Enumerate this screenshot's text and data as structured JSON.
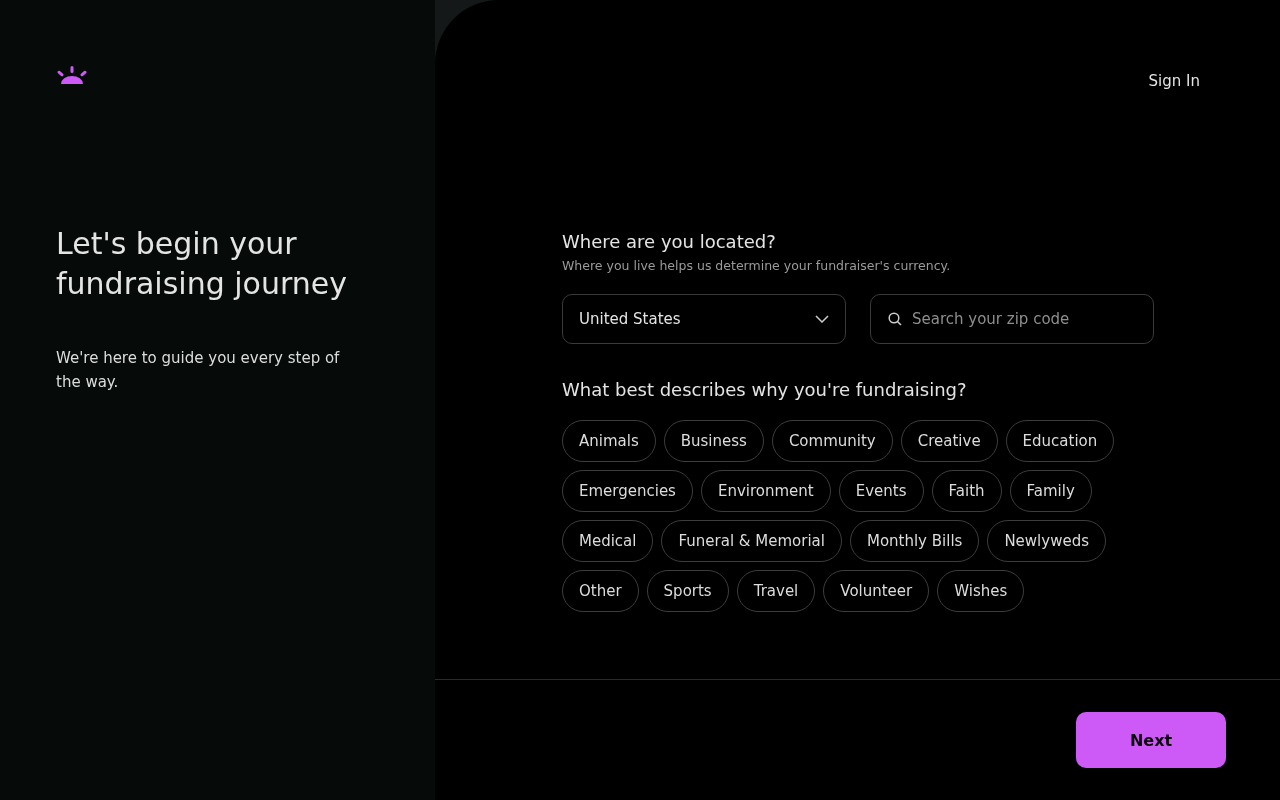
{
  "sidebar": {
    "heading": "Let's begin your fundraising journey",
    "subtext": "We're here to guide you every step of the way."
  },
  "header": {
    "sign_in": "Sign In"
  },
  "location": {
    "question": "Where are you located?",
    "hint": "Where you live helps us determine your fundraiser's currency.",
    "country": "United States",
    "zip": {
      "placeholder": "Search your zip code"
    }
  },
  "reason": {
    "question": "What best describes why you're fundraising?",
    "categories": [
      {
        "label": "Animals",
        "selected": false
      },
      {
        "label": "Business",
        "selected": false
      },
      {
        "label": "Community",
        "selected": false
      },
      {
        "label": "Creative",
        "selected": false
      },
      {
        "label": "Education",
        "selected": false
      },
      {
        "label": "Emergencies",
        "selected": false
      },
      {
        "label": "Environment",
        "selected": false
      },
      {
        "label": "Events",
        "selected": false
      },
      {
        "label": "Faith",
        "selected": false
      },
      {
        "label": "Family",
        "selected": false
      },
      {
        "label": "Medical",
        "selected": false
      },
      {
        "label": "Funeral & Memorial",
        "selected": false
      },
      {
        "label": "Monthly Bills",
        "selected": false
      },
      {
        "label": "Newlyweds",
        "selected": false
      },
      {
        "label": "Other",
        "selected": false
      },
      {
        "label": "Sports",
        "selected": false
      },
      {
        "label": "Travel",
        "selected": false
      },
      {
        "label": "Volunteer",
        "selected": false
      },
      {
        "label": "Wishes",
        "selected": false
      }
    ]
  },
  "footer": {
    "next": "Next"
  }
}
